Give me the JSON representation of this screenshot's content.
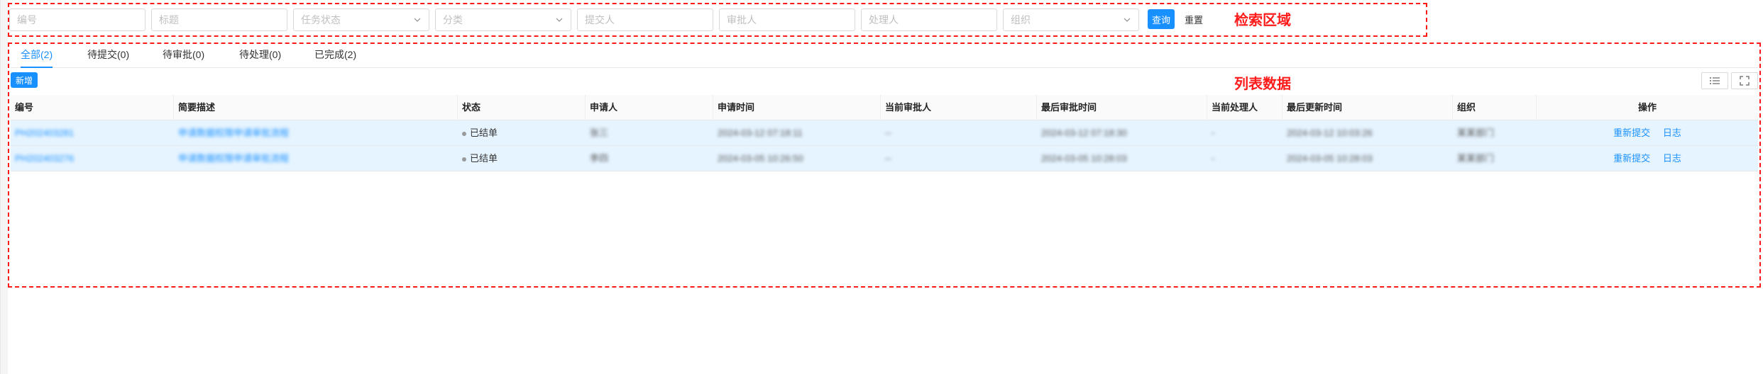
{
  "search": {
    "fields": [
      {
        "placeholder": "编号",
        "type": "input"
      },
      {
        "placeholder": "标题",
        "type": "input"
      },
      {
        "placeholder": "任务状态",
        "type": "select"
      },
      {
        "placeholder": "分类",
        "type": "select"
      },
      {
        "placeholder": "提交人",
        "type": "input"
      },
      {
        "placeholder": "审批人",
        "type": "input"
      },
      {
        "placeholder": "处理人",
        "type": "input"
      },
      {
        "placeholder": "组织",
        "type": "select"
      }
    ],
    "query_label": "查询",
    "reset_label": "重置",
    "annotation": "检索区域"
  },
  "list": {
    "annotation": "列表数据",
    "tabs": [
      {
        "label": "全部(2)",
        "active": true
      },
      {
        "label": "待提交(0)",
        "active": false
      },
      {
        "label": "待审批(0)",
        "active": false
      },
      {
        "label": "待处理(0)",
        "active": false
      },
      {
        "label": "已完成(2)",
        "active": false
      }
    ],
    "add_label": "新增",
    "columns": [
      "编号",
      "简要描述",
      "状态",
      "申请人",
      "申请时间",
      "当前审批人",
      "最后审批时间",
      "当前处理人",
      "最后更新时间",
      "组织",
      "操作"
    ],
    "rows": [
      {
        "id": "PH202403281",
        "desc": "申请数据权限申请审批流程",
        "status": "已结单",
        "applicant": "张三",
        "apply_time": "2024-03-12 07:18:11",
        "approver": "--",
        "last_approve_time": "2024-03-12 07:18:30",
        "handler": "-",
        "update_time": "2024-03-12 10:03:26",
        "org": "某某部门",
        "actions": [
          "重新提交",
          "日志"
        ]
      },
      {
        "id": "PH202403276",
        "desc": "申请数据权限申请审批流程",
        "status": "已结单",
        "applicant": "李四",
        "apply_time": "2024-03-05 10:26:50",
        "approver": "--",
        "last_approve_time": "2024-03-05 10:28:03",
        "handler": "-",
        "update_time": "2024-03-05 10:28:03",
        "org": "某某部门",
        "actions": [
          "重新提交",
          "日志"
        ]
      }
    ]
  },
  "colors": {
    "primary": "#1890ff",
    "annotation": "#ff1a1a",
    "row_highlight": "#e6f4ff"
  }
}
